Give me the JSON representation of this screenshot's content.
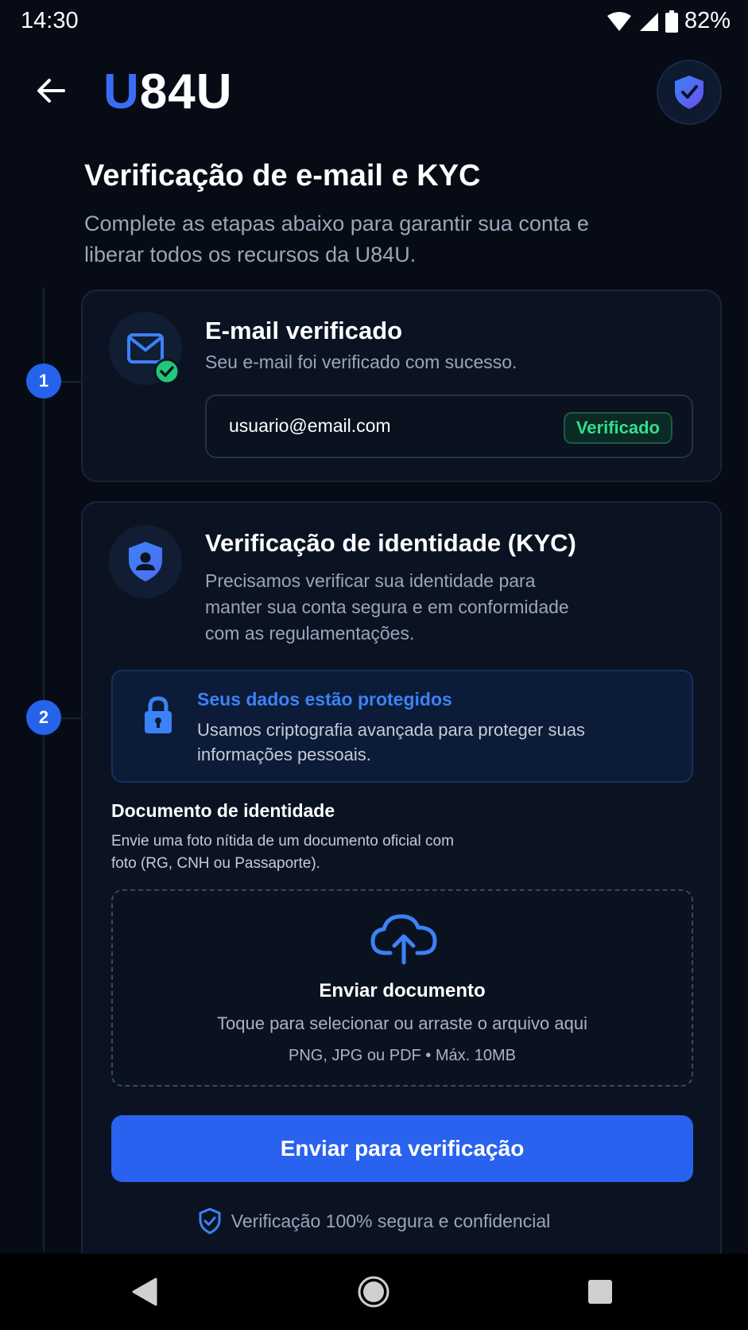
{
  "status_bar": {
    "time": "14:30",
    "battery": "82%"
  },
  "header": {
    "logo_first": "U",
    "logo_rest": "84U"
  },
  "page": {
    "title": "Verificação de e-mail e KYC",
    "subtitle": "Complete as etapas abaixo para garantir sua conta e liberar todos os recursos da U84U."
  },
  "steps": [
    {
      "number": "1"
    },
    {
      "number": "2"
    }
  ],
  "email_card": {
    "title": "E-mail verificado",
    "description": "Seu e-mail foi verificado com sucesso.",
    "email": "usuario@email.com",
    "badge": "Verificado"
  },
  "kyc_card": {
    "title": "Verificação de identidade (KYC)",
    "description": "Precisamos verificar sua identidade para manter sua conta segura e em conformidade com as regulamentações.",
    "protected_title": "Seus dados estão protegidos",
    "protected_text": "Usamos criptografia avançada para proteger suas informações pessoais.",
    "document_title": "Documento de identidade",
    "document_text": "Envie uma foto nítida de um documento oficial com foto (RG, CNH ou Passaporte).",
    "upload_title": "Enviar documento",
    "upload_hint": "Toque para selecionar ou arraste o arquivo aqui",
    "upload_formats": "PNG, JPG ou PDF • Máx. 10MB",
    "submit_label": "Enviar para verificação",
    "secure_text": "Verificação 100% segura e confidencial"
  },
  "icons": {
    "back": "arrow-left-icon",
    "header": "shield-check-icon",
    "email": "mail-icon",
    "check": "check-circle-icon",
    "kyc": "shield-user-icon",
    "lock": "lock-icon",
    "upload": "cloud-upload-icon",
    "secure": "shield-check-outline-icon"
  },
  "colors": {
    "background": "#060b16",
    "accent": "#2962ef",
    "success": "#2ee08c",
    "link": "#3b82f6"
  }
}
